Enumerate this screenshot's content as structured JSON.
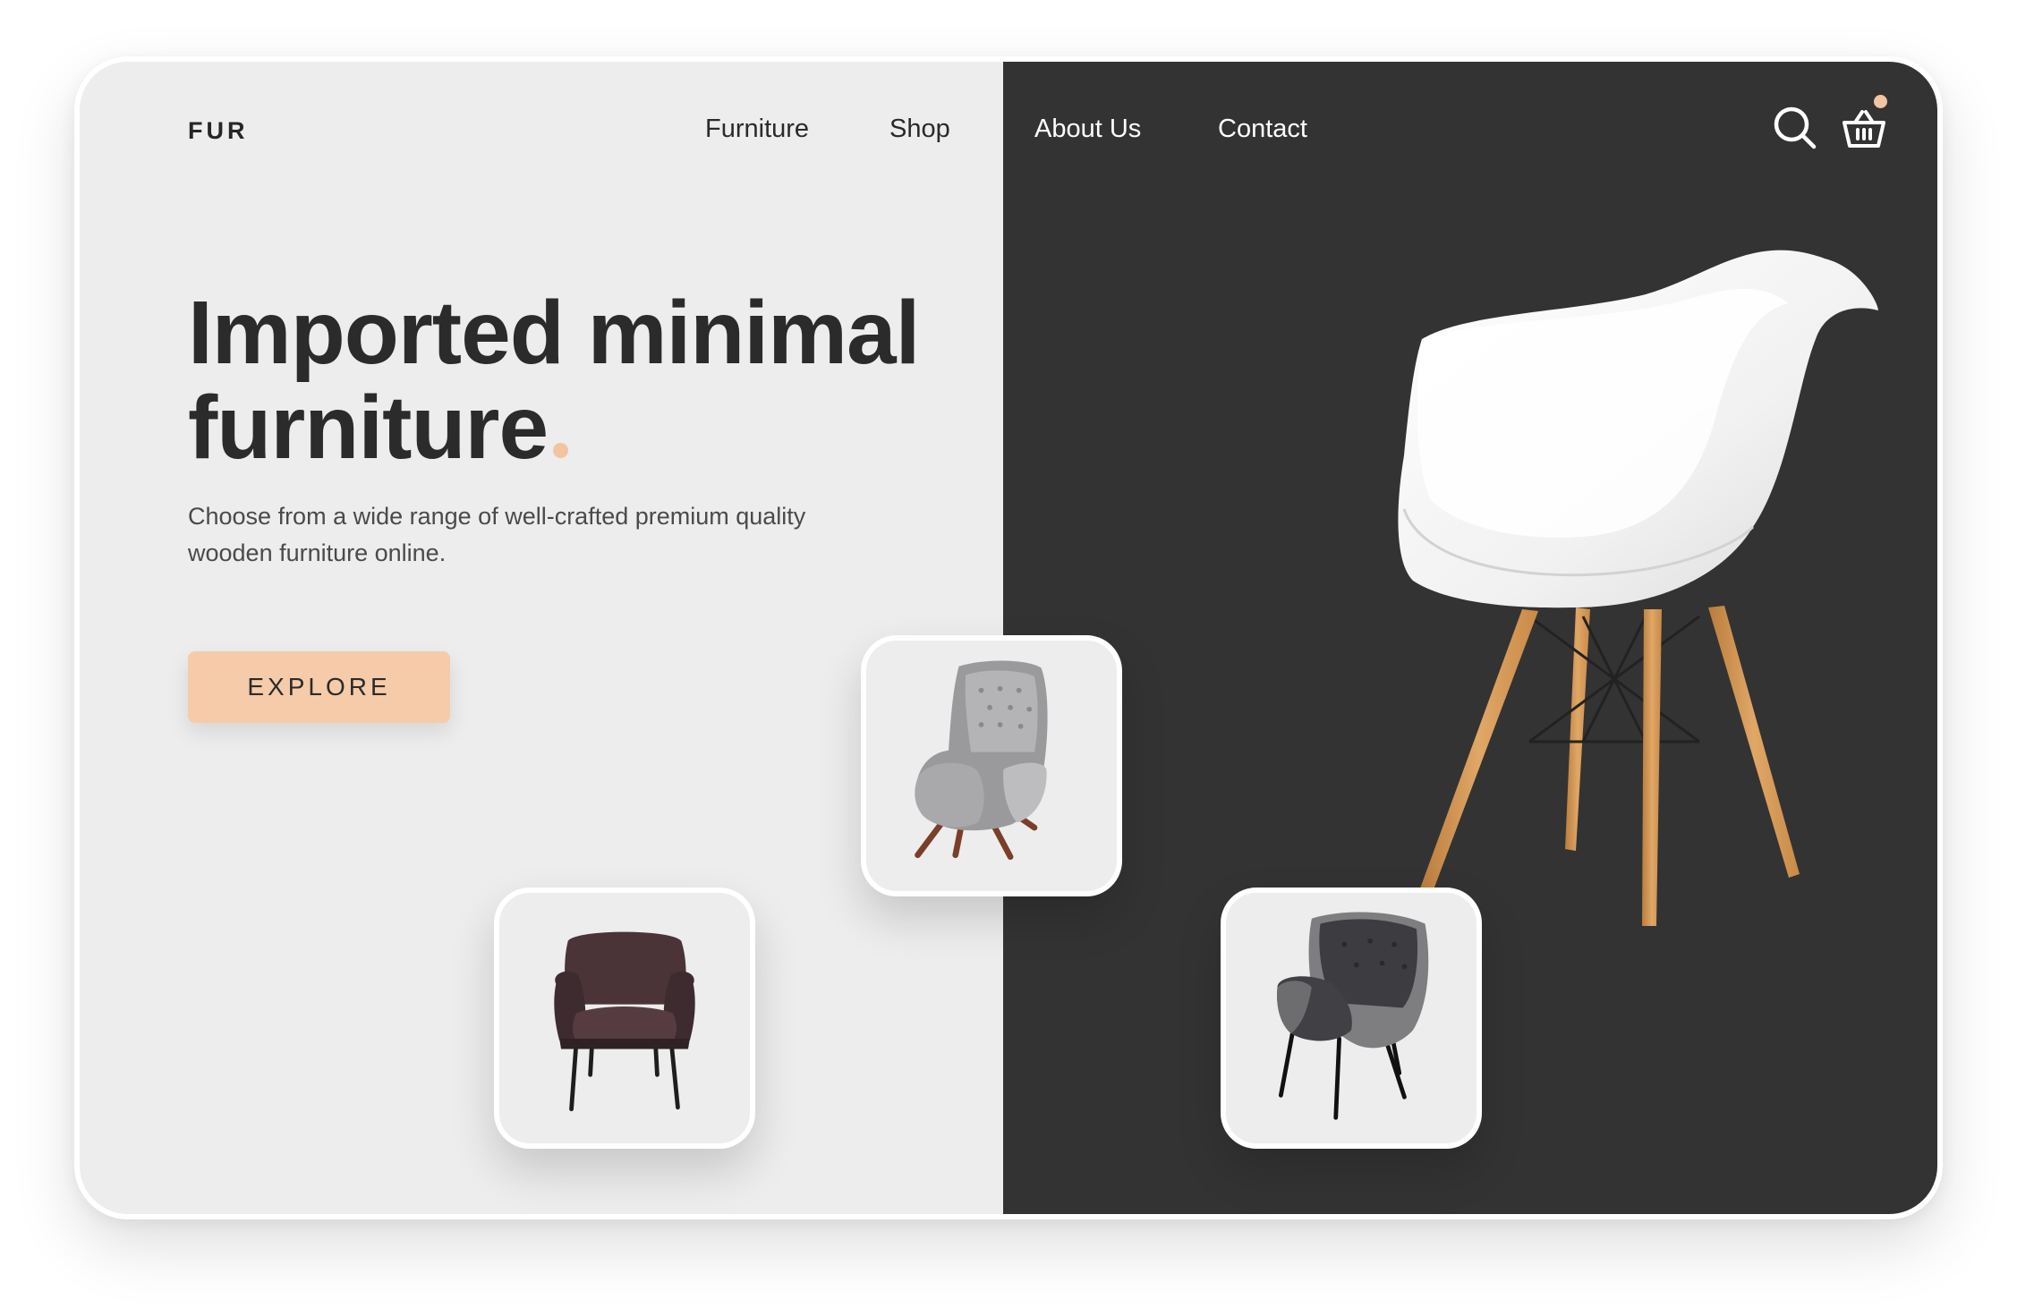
{
  "brand": {
    "logo": "FUR"
  },
  "nav": {
    "items": [
      {
        "label": "Furniture"
      },
      {
        "label": "Shop"
      },
      {
        "label": "About Us"
      },
      {
        "label": "Contact"
      }
    ]
  },
  "header_icons": {
    "search": "search-icon",
    "cart": "basket-icon",
    "cart_badge": "notification-dot"
  },
  "hero": {
    "headline_line1": "Imported minimal",
    "headline_line2": "furniture",
    "subtitle": "Choose from a wide range of well-crafted premium quality wooden furniture online.",
    "cta_label": "EXPLORE"
  },
  "products": [
    {
      "image": "grey-velvet-wingback-armchair"
    },
    {
      "image": "brown-leather-armchair"
    },
    {
      "image": "grey-tufted-dining-armchair"
    }
  ],
  "featured_image": "white-shell-chair-wooden-legs",
  "colors": {
    "accent": "#f5cba9",
    "dark_panel": "#333333",
    "light_panel": "#ededed",
    "text_dark": "#2b2b2b"
  }
}
